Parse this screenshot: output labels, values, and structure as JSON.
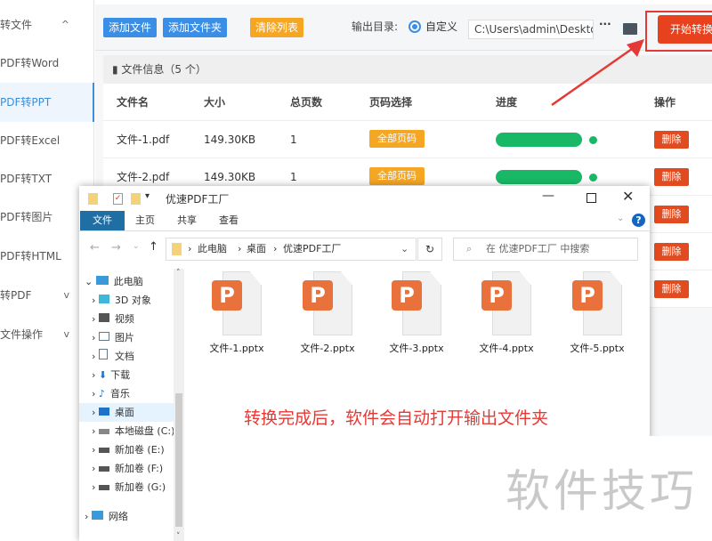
{
  "sidebar": {
    "items": [
      {
        "label": "转文件",
        "chevron": "^"
      },
      {
        "label": "PDF转Word"
      },
      {
        "label": "PDF转PPT"
      },
      {
        "label": "PDF转Excel"
      },
      {
        "label": "PDF转TXT"
      },
      {
        "label": "PDF转图片"
      },
      {
        "label": "PDF转HTML"
      },
      {
        "label": "转PDF",
        "chevron": "v"
      },
      {
        "label": "文件操作",
        "chevron": "v"
      }
    ]
  },
  "toolbar": {
    "add_file": "添加文件",
    "add_folder": "添加文件夹",
    "clear": "清除列表",
    "output_label": "输出目录:",
    "radio_label": "自定义",
    "path": "C:\\Users\\admin\\Deskto",
    "more": "···",
    "start": "开始转换"
  },
  "table": {
    "info": "文件信息（5 个）",
    "headers": [
      "文件名",
      "大小",
      "总页数",
      "页码选择",
      "进度",
      "操作"
    ],
    "rows": [
      {
        "name": "文件-1.pdf",
        "size": "149.30KB",
        "pages": "1",
        "page_sel": "全部页码",
        "progress": 100,
        "action": "删除"
      },
      {
        "name": "文件-2.pdf",
        "size": "149.30KB",
        "pages": "1",
        "page_sel": "全部页码",
        "progress": 100,
        "action": "删除"
      },
      {
        "action": "删除"
      },
      {
        "action": "删除"
      },
      {
        "action": "删除"
      }
    ]
  },
  "explorer": {
    "title": "优速PDF工厂",
    "tabs": [
      "文件",
      "主页",
      "共享",
      "查看"
    ],
    "breadcrumb": [
      "此电脑",
      "桌面",
      "优速PDF工厂"
    ],
    "search_placeholder": "在 优速PDF工厂 中搜索",
    "nav": [
      "此电脑",
      "3D 对象",
      "视频",
      "图片",
      "文档",
      "下载",
      "音乐",
      "桌面",
      "本地磁盘 (C:)",
      "新加卷 (E:)",
      "新加卷 (F:)",
      "新加卷 (G:)",
      "网络"
    ],
    "files": [
      "文件-1.pptx",
      "文件-2.pptx",
      "文件-3.pptx",
      "文件-4.pptx",
      "文件-5.pptx"
    ]
  },
  "caption": "转换完成后，软件会自动打开输出文件夹",
  "watermark": "软件技巧",
  "colors": {
    "accent": "#3a8ee6",
    "start": "#e8411d",
    "progress": "#19b866",
    "caption": "#e53935"
  }
}
